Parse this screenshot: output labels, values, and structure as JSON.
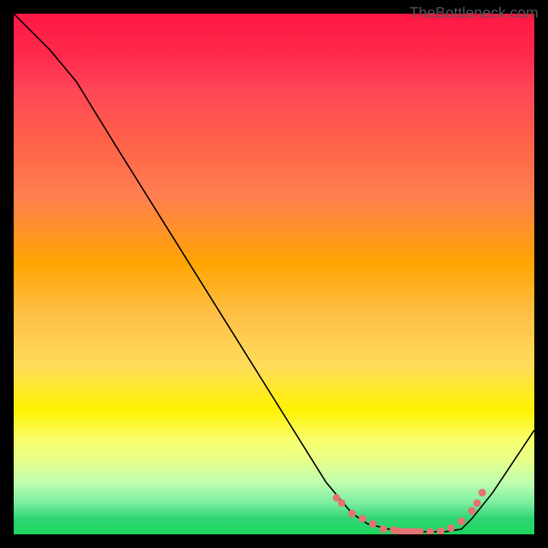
{
  "watermark": "TheBottleneck.com",
  "chart_data": {
    "type": "line",
    "title": "",
    "xlabel": "",
    "ylabel": "",
    "xlim": [
      0,
      100
    ],
    "ylim": [
      0,
      100
    ],
    "grid": false,
    "series": [
      {
        "name": "curve",
        "x": [
          0,
          7,
          12,
          20,
          30,
          40,
          50,
          60,
          65,
          68,
          72,
          76,
          80,
          83,
          86,
          88,
          92,
          96,
          100
        ],
        "values": [
          100,
          93,
          87,
          74,
          58,
          42,
          26,
          10,
          4,
          2,
          1,
          0.5,
          0.5,
          0.5,
          1,
          3,
          8,
          14,
          20
        ]
      }
    ],
    "markers": {
      "name": "highlight",
      "x": [
        62,
        63,
        65,
        67,
        69,
        71,
        73,
        74,
        75,
        76,
        77,
        78,
        80,
        82,
        84,
        86,
        88,
        89,
        90
      ],
      "values": [
        7,
        6,
        4,
        3,
        2,
        1,
        0.8,
        0.6,
        0.5,
        0.5,
        0.5,
        0.5,
        0.5,
        0.6,
        1.2,
        2.5,
        4.5,
        6,
        8
      ]
    },
    "background": {
      "type": "vertical-gradient",
      "stops": [
        {
          "pos": 0,
          "color": "#ff1744"
        },
        {
          "pos": 50,
          "color": "#ffc048"
        },
        {
          "pos": 80,
          "color": "#fff200"
        },
        {
          "pos": 100,
          "color": "#1dd65f"
        }
      ]
    }
  }
}
